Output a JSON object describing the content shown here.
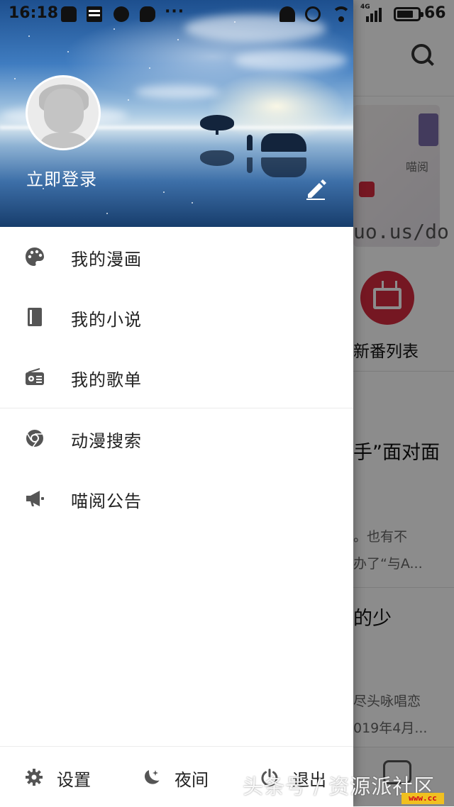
{
  "status_bar": {
    "time": "16:18",
    "network": "4G",
    "battery": "66",
    "overflow": "···"
  },
  "background_app": {
    "banner_caption": "喵阅",
    "banner_url_fragment": "uo.us/do",
    "new_anime_list": "新番列表",
    "article1_title_fragment": "手”面对面",
    "article1_line1": "。也有不",
    "article1_line2": "办了“与A...",
    "article2_title_fragment": "的少",
    "article2_line1": "尽头咏唱恋",
    "article2_line2": "019年4月..."
  },
  "drawer": {
    "login_label": "立即登录",
    "menu": [
      {
        "label": "我的漫画",
        "icon": "palette-icon"
      },
      {
        "label": "我的小说",
        "icon": "book-icon"
      },
      {
        "label": "我的歌单",
        "icon": "radio-icon"
      },
      {
        "label": "动漫搜索",
        "icon": "chrome-icon"
      },
      {
        "label": "喵阅公告",
        "icon": "megaphone-icon"
      }
    ],
    "bottom": {
      "settings": "设置",
      "night": "夜间",
      "logout": "退出"
    }
  },
  "watermark": {
    "text": "头条号 / 资源派社区",
    "badge": "www.cc"
  },
  "colors": {
    "accent_red": "#d62a3f",
    "icon_gray": "#555555",
    "text_dark": "#222222"
  }
}
